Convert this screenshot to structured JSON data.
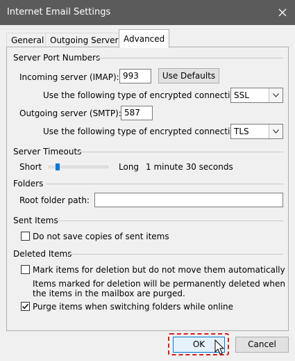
{
  "window": {
    "title": "Internet Email Settings"
  },
  "tabs": [
    {
      "label": "General"
    },
    {
      "label": "Outgoing Server"
    },
    {
      "label": "Advanced"
    }
  ],
  "server_ports": {
    "heading": "Server Port Numbers",
    "incoming_label": "Incoming server (IMAP):",
    "incoming_value": "993",
    "use_defaults_label": "Use Defaults",
    "incoming_enc_label": "Use the following type of encrypted connection:",
    "incoming_enc_value": "SSL",
    "outgoing_label": "Outgoing server (SMTP):",
    "outgoing_value": "587",
    "outgoing_enc_label": "Use the following type of encrypted connection:",
    "outgoing_enc_value": "TLS"
  },
  "timeouts": {
    "heading": "Server Timeouts",
    "short_label": "Short",
    "long_label": "Long",
    "value_text": "1 minute 30 seconds",
    "slider_fraction": 0.12
  },
  "folders": {
    "heading": "Folders",
    "root_label": "Root folder path:",
    "root_value": ""
  },
  "sent_items": {
    "heading": "Sent Items",
    "no_copies_label": "Do not save copies of sent items",
    "no_copies_checked": false
  },
  "deleted_items": {
    "heading": "Deleted Items",
    "mark_label": "Mark items for deletion but do not move them automatically",
    "mark_checked": false,
    "note_line1": "Items marked for deletion will be permanently deleted when",
    "note_line2": "the items in the mailbox are purged.",
    "purge_label": "Purge items when switching folders while online",
    "purge_checked": true
  },
  "footer": {
    "ok_label": "OK",
    "cancel_label": "Cancel"
  },
  "colors": {
    "titlebar": "#5b5b5b",
    "accent": "#0078d7",
    "highlight_border": "#d31c1c"
  }
}
